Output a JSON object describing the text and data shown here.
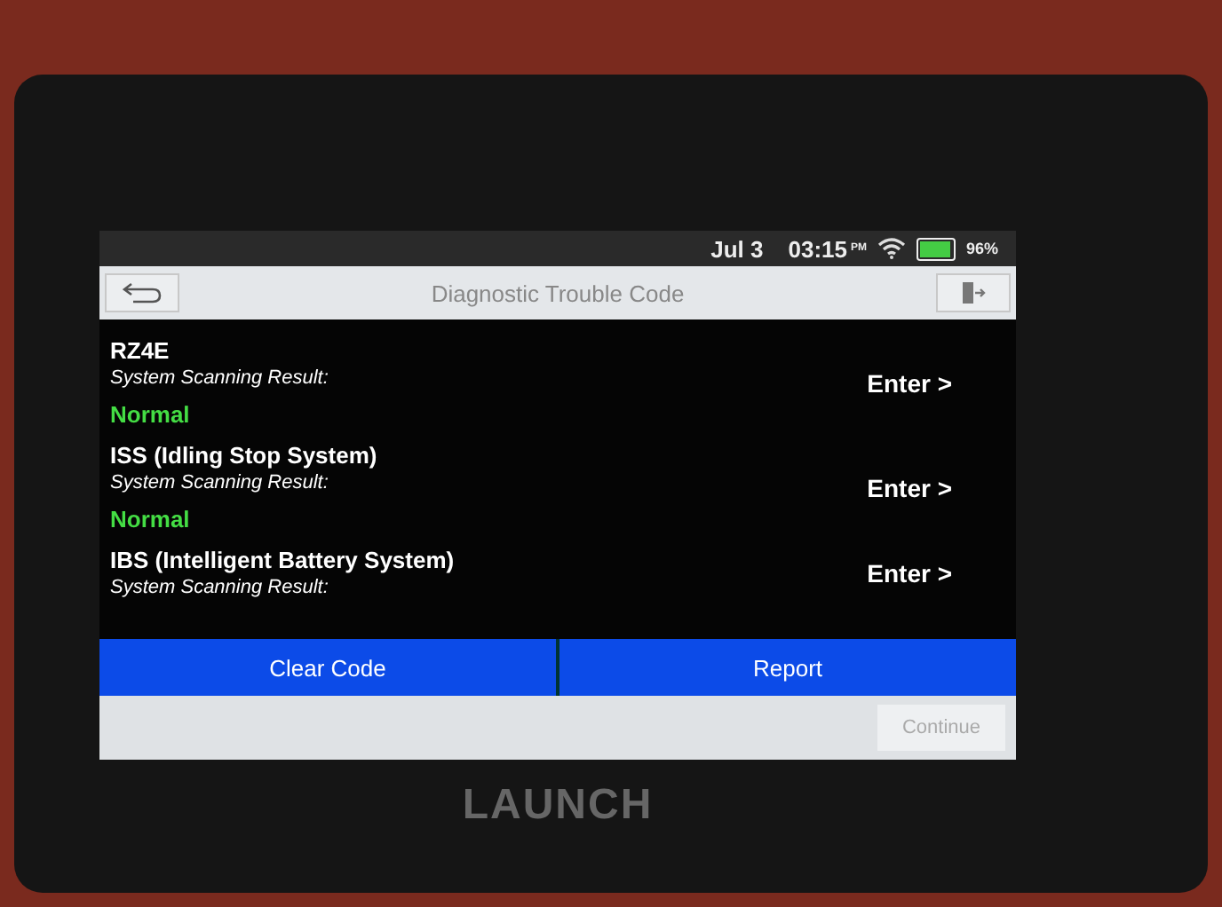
{
  "status_bar": {
    "date": "Jul 3",
    "time": "03:15",
    "ampm": "PM",
    "battery": "96%"
  },
  "header": {
    "title": "Diagnostic Trouble Code"
  },
  "systems": [
    {
      "name": "RZ4E",
      "result_label": "System Scanning Result:",
      "result": "Normal",
      "action": "Enter >"
    },
    {
      "name": "ISS (Idling Stop System)",
      "result_label": "System Scanning Result:",
      "result": "Normal",
      "action": "Enter >"
    },
    {
      "name": "IBS (Intelligent Battery System)",
      "result_label": "System Scanning Result:",
      "action": "Enter >"
    }
  ],
  "buttons": [
    {
      "label": "Clear Code"
    },
    {
      "label": "Report"
    }
  ],
  "footer": {
    "continue": {
      "label": "Continue",
      "disabled": true
    }
  },
  "device": {
    "brand": "LAUNCH"
  }
}
